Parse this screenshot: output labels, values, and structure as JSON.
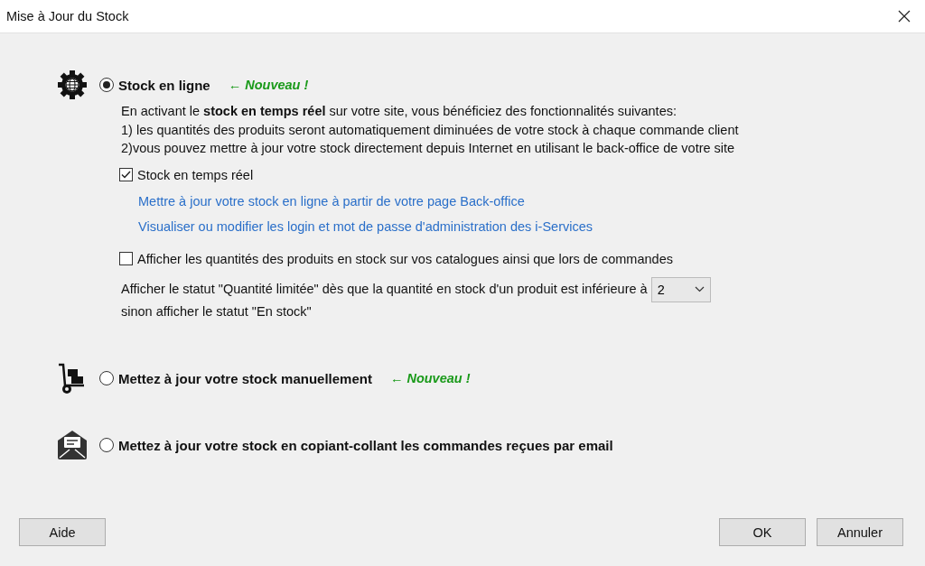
{
  "window": {
    "title": "Mise à Jour du Stock"
  },
  "options": [
    {
      "kind": "online",
      "label": "Stock en ligne",
      "selected": true,
      "badge": "← Nouveau !",
      "details": {
        "intro": "En activant le **stock en temps réel** sur votre site, vous bénéficiez des fonctionnalités suivantes:",
        "lines": [
          "1) les quantités des produits seront automatiquement diminuées de votre stock à chaque commande client",
          "2)vous pouvez mettre à jour votre stock directement depuis Internet en utilisant le back-office de votre site"
        ],
        "realtime": {
          "label": "Stock en temps réel",
          "checked": true
        },
        "links": [
          "Mettre à jour votre stock en ligne à partir de votre page Back-office",
          "Visualiser ou modifier les login et mot de passe d'administration des i-Services"
        ],
        "show_quantities": {
          "label": "Afficher les quantités des produits en stock sur vos catalogues ainsi que lors de commandes",
          "checked": false
        },
        "threshold": {
          "text": "Afficher le statut \"Quantité limitée\" dès que la quantité en stock d'un produit est inférieure à",
          "value": "2",
          "text_after": "sinon afficher le statut \"En stock\""
        }
      }
    },
    {
      "kind": "manual",
      "label": "Mettez à jour votre stock manuellement",
      "selected": false,
      "badge": "← Nouveau !"
    },
    {
      "kind": "email",
      "label": "Mettez à jour votre stock en copiant-collant les commandes reçues par email",
      "selected": false
    }
  ],
  "buttons": {
    "help": "Aide",
    "ok": "OK",
    "cancel": "Annuler"
  }
}
